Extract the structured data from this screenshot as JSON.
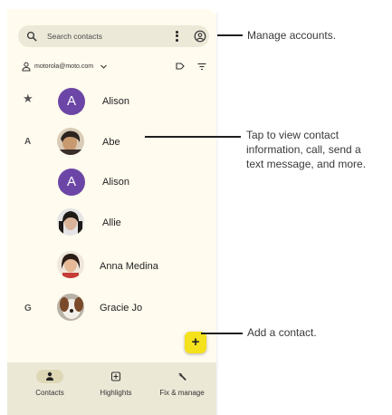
{
  "search": {
    "placeholder": "Search contacts",
    "menu_icon": "more-vert-icon",
    "account_icon": "account-circle-icon",
    "search_icon": "search-icon"
  },
  "account": {
    "email": "motorola@moto.com",
    "person_icon": "person-icon",
    "chevron_icon": "chevron-down-icon",
    "label_icon": "label-icon",
    "filter_icon": "filter-icon"
  },
  "sections": {
    "favorites_icon": "star-icon",
    "a": "A",
    "g": "G"
  },
  "contacts": [
    {
      "name": "Alison",
      "avatar_letter": "A"
    },
    {
      "name": "Abe"
    },
    {
      "name": "Alison",
      "avatar_letter": "A"
    },
    {
      "name": "Allie"
    },
    {
      "name": "Anna Medina"
    },
    {
      "name": "Gracie Jo"
    }
  ],
  "fab": {
    "label": "+"
  },
  "bottom_nav": {
    "items": [
      {
        "label": "Contacts",
        "icon": "person-icon",
        "active": true
      },
      {
        "label": "Highlights",
        "icon": "highlights-icon",
        "active": false
      },
      {
        "label": "Fix & manage",
        "icon": "wrench-icon",
        "active": false
      }
    ]
  },
  "callouts": {
    "manage_accounts": "Manage accounts.",
    "tap_contact": [
      "Tap to view contact",
      "information, call, send a",
      "text message, and more."
    ],
    "add_contact": "Add a contact."
  },
  "colors": {
    "background": "#fffbee",
    "avatar_purple": "#6c46a6",
    "fab_yellow": "#f5e11c",
    "nav_bg": "#ece8d6"
  }
}
